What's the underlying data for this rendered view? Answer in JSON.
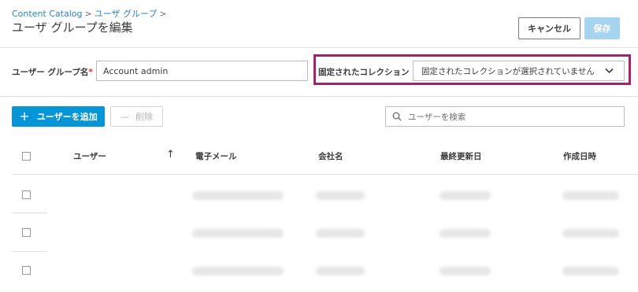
{
  "breadcrumb": {
    "items": [
      "Content Catalog",
      "ユーザ グループ"
    ],
    "separator": ">"
  },
  "page": {
    "title": "ユーザ グループを編集"
  },
  "actions": {
    "cancel_label": "キャンセル",
    "save_label": "保存"
  },
  "form": {
    "name_label": "ユーザー グループ名",
    "required_mark": "*",
    "name_value": "Account admin",
    "collection_label": "固定されたコレクション",
    "collection_value": "固定されたコレクションが選択されていません"
  },
  "toolbar": {
    "add_label": "ユーザーを追加",
    "delete_label": "削除",
    "search_placeholder": "ユーザーを検索"
  },
  "table": {
    "columns": [
      "ユーザー",
      "電子メール",
      "会社名",
      "最終更新日",
      "作成日時"
    ],
    "sort_indicator": "↑",
    "rows": [
      {
        "user": "",
        "email": "",
        "company": "",
        "modified": "",
        "created": ""
      },
      {
        "user": "",
        "email": "",
        "company": "",
        "modified": "",
        "created": ""
      },
      {
        "user": "",
        "email": "",
        "company": "",
        "modified": "",
        "created": ""
      }
    ]
  },
  "colors": {
    "accent": "#0696d7",
    "link": "#2b85c5",
    "highlight": "#a1246e",
    "save_disabled": "#a6d3f0"
  }
}
